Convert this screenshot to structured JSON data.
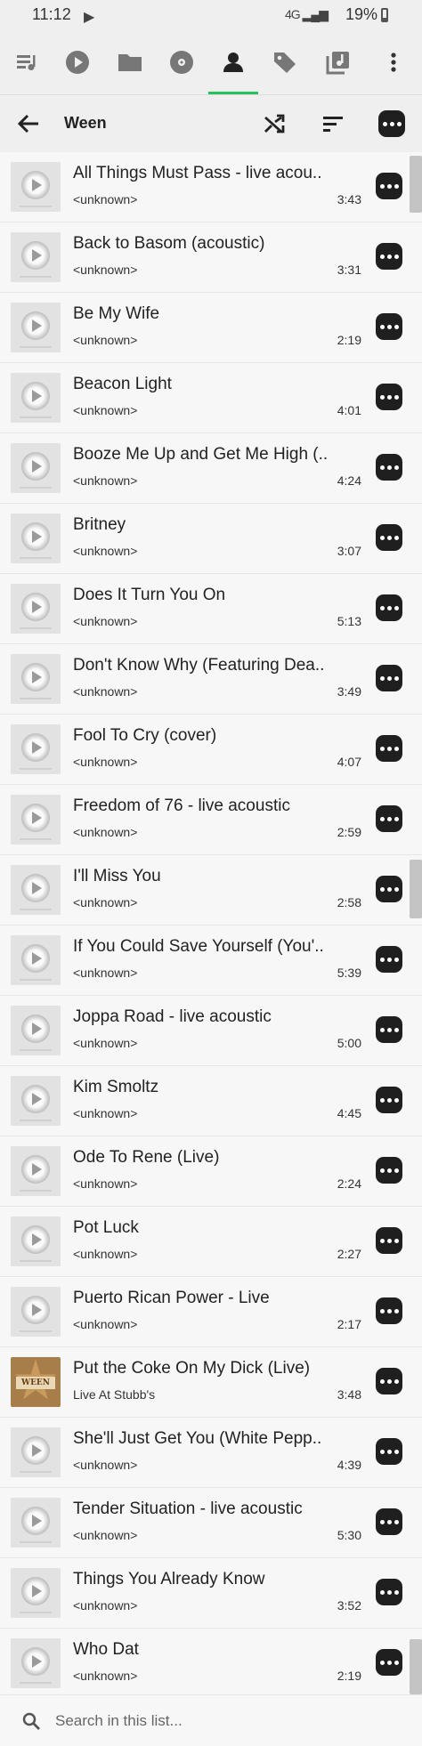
{
  "status_bar": {
    "time": "11:12",
    "signal_text": "4G",
    "battery": "19%"
  },
  "tabs": [
    {
      "name": "queue-icon"
    },
    {
      "name": "play-circle-icon"
    },
    {
      "name": "folder-icon"
    },
    {
      "name": "disc-icon"
    },
    {
      "name": "person-icon",
      "active": true
    },
    {
      "name": "tag-icon"
    },
    {
      "name": "playlist-icon"
    },
    {
      "name": "more-vert-icon"
    }
  ],
  "toolbar": {
    "title": "Ween"
  },
  "songs": [
    {
      "title": "All Things Must Pass - live acou..",
      "subtitle": "<unknown>",
      "duration": "3:43"
    },
    {
      "title": "Back to Basom (acoustic)",
      "subtitle": "<unknown>",
      "duration": "3:31"
    },
    {
      "title": "Be My Wife",
      "subtitle": "<unknown>",
      "duration": "2:19"
    },
    {
      "title": "Beacon Light",
      "subtitle": "<unknown>",
      "duration": "4:01"
    },
    {
      "title": "Booze Me Up and Get Me High (..",
      "subtitle": "<unknown>",
      "duration": "4:24"
    },
    {
      "title": "Britney",
      "subtitle": "<unknown>",
      "duration": "3:07"
    },
    {
      "title": "Does It Turn You On",
      "subtitle": "<unknown>",
      "duration": "5:13"
    },
    {
      "title": "Don't Know Why (Featuring Dea..",
      "subtitle": "<unknown>",
      "duration": "3:49"
    },
    {
      "title": "Fool To Cry (cover)",
      "subtitle": "<unknown>",
      "duration": "4:07"
    },
    {
      "title": "Freedom of 76 - live acoustic",
      "subtitle": "<unknown>",
      "duration": "2:59"
    },
    {
      "title": "I'll Miss You",
      "subtitle": "<unknown>",
      "duration": "2:58"
    },
    {
      "title": "If You Could Save Yourself (You'..",
      "subtitle": "<unknown>",
      "duration": "5:39"
    },
    {
      "title": "Joppa Road - live acoustic",
      "subtitle": "<unknown>",
      "duration": "5:00"
    },
    {
      "title": "Kim Smoltz",
      "subtitle": "<unknown>",
      "duration": "4:45"
    },
    {
      "title": "Ode To Rene (Live)",
      "subtitle": "<unknown>",
      "duration": "2:24"
    },
    {
      "title": "Pot Luck",
      "subtitle": "<unknown>",
      "duration": "2:27"
    },
    {
      "title": "Puerto Rican Power - Live",
      "subtitle": "<unknown>",
      "duration": "2:17"
    },
    {
      "title": "Put the Coke On My Dick (Live)",
      "subtitle": "Live At Stubb's",
      "duration": "3:48",
      "album_art": true,
      "art_text": "WEEN"
    },
    {
      "title": "She'll Just Get You (White Pepp..",
      "subtitle": "<unknown>",
      "duration": "4:39"
    },
    {
      "title": "Tender Situation - live acoustic",
      "subtitle": "<unknown>",
      "duration": "5:30"
    },
    {
      "title": "Things You Already Know",
      "subtitle": "<unknown>",
      "duration": "3:52"
    },
    {
      "title": "Who Dat",
      "subtitle": "<unknown>",
      "duration": "2:19"
    }
  ],
  "search": {
    "placeholder": "Search in this list..."
  },
  "colors": {
    "accent": "#27c35a",
    "background": "#f2f2f2"
  }
}
